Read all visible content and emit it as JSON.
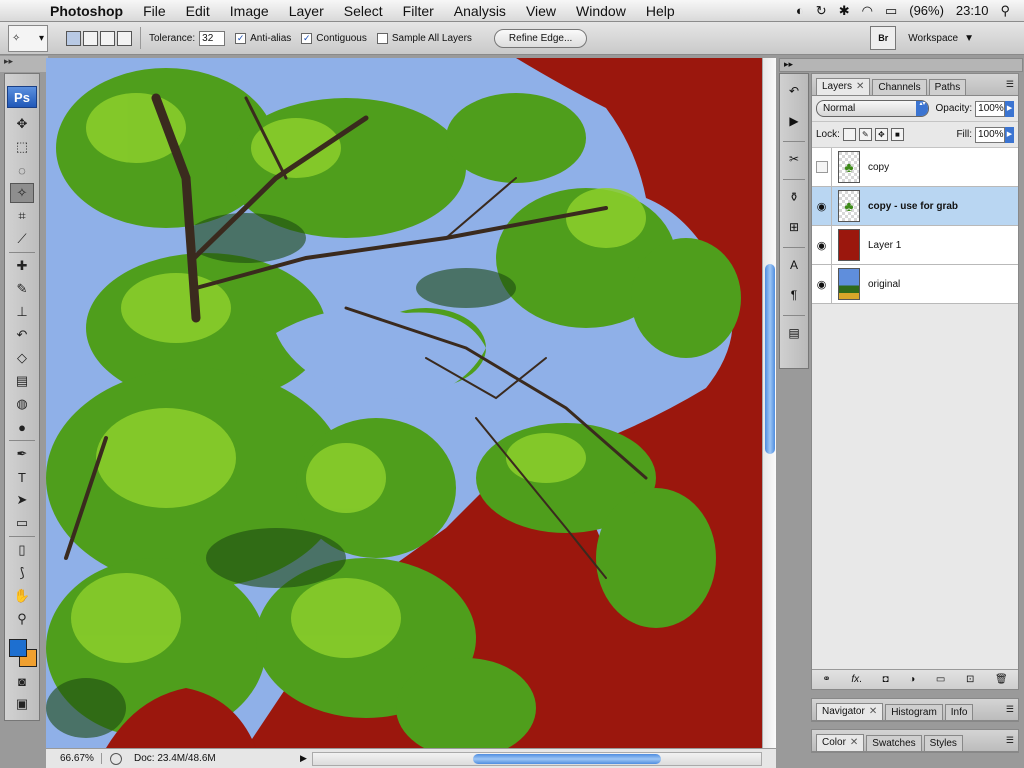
{
  "menubar": {
    "apple": "",
    "app": "Photoshop",
    "items": [
      "File",
      "Edit",
      "Image",
      "Layer",
      "Select",
      "Filter",
      "Analysis",
      "View",
      "Window",
      "Help"
    ],
    "battery": "(96%)",
    "clock": "23:10"
  },
  "options": {
    "tolerance_label": "Tolerance:",
    "tolerance_value": "32",
    "anti_alias": "Anti-alias",
    "contiguous": "Contiguous",
    "sample_all": "Sample All Layers",
    "refine_edge": "Refine Edge...",
    "bridge": "Br",
    "workspace": "Workspace"
  },
  "toolbox": {
    "logo": "Ps"
  },
  "status": {
    "zoom": "66.67%",
    "doc": "Doc: 23.4M/48.6M"
  },
  "layers_panel": {
    "tabs": [
      "Layers",
      "Channels",
      "Paths"
    ],
    "blend_mode": "Normal",
    "opacity_label": "Opacity:",
    "opacity": "100%",
    "lock_label": "Lock:",
    "fill_label": "Fill:",
    "fill": "100%",
    "layers": [
      {
        "name": "copy",
        "visible": false,
        "selected": false
      },
      {
        "name": "copy - use for grab",
        "visible": true,
        "selected": true
      },
      {
        "name": "Layer 1",
        "visible": true,
        "selected": false
      },
      {
        "name": "original",
        "visible": true,
        "selected": false
      }
    ]
  },
  "nav_panel": {
    "tabs": [
      "Navigator",
      "Histogram",
      "Info"
    ]
  },
  "color_panel": {
    "tabs": [
      "Color",
      "Swatches",
      "Styles"
    ]
  },
  "colors": {
    "background_fill": "#9b170d",
    "sky": "#8fb0e8",
    "foliage": "#4f9e1c"
  }
}
